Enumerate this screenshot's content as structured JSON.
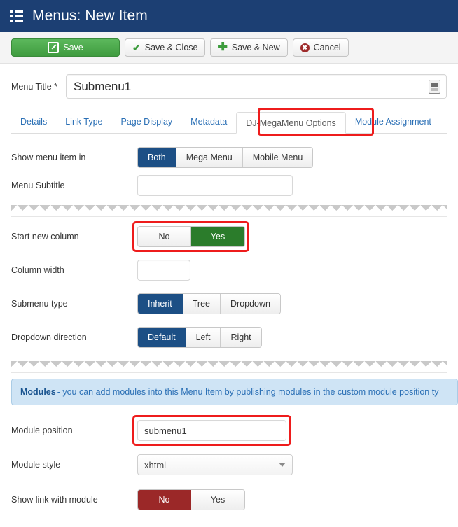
{
  "header": {
    "icon": "menu-list-icon",
    "title": "Menus: New Item"
  },
  "toolbar": {
    "save_label": "Save",
    "save_close_label": "Save & Close",
    "save_new_label": "Save & New",
    "cancel_label": "Cancel",
    "save_icon": "edit-pencil-icon",
    "save_close_icon": "check-icon",
    "save_new_icon": "plus-icon",
    "cancel_icon": "close-circle-icon"
  },
  "menu_title": {
    "label": "Menu Title *",
    "value": "Submenu1",
    "addon_icon": "article-icon"
  },
  "tabs": [
    {
      "label": "Details",
      "active": false
    },
    {
      "label": "Link Type",
      "active": false
    },
    {
      "label": "Page Display",
      "active": false
    },
    {
      "label": "Metadata",
      "active": false
    },
    {
      "label": "DJ-MegaMenu Options",
      "active": true
    },
    {
      "label": "Module Assignment",
      "active": false
    }
  ],
  "fields": {
    "show_menu_item_in": {
      "label": "Show menu item in",
      "options": [
        "Both",
        "Mega Menu",
        "Mobile Menu"
      ],
      "selected": "Both"
    },
    "menu_subtitle": {
      "label": "Menu Subtitle",
      "value": "",
      "placeholder": ""
    },
    "start_new_column": {
      "label": "Start new column",
      "options": [
        "No",
        "Yes"
      ],
      "selected": "Yes"
    },
    "column_width": {
      "label": "Column width",
      "value": "",
      "placeholder": ""
    },
    "submenu_type": {
      "label": "Submenu type",
      "options": [
        "Inherit",
        "Tree",
        "Dropdown"
      ],
      "selected": "Inherit"
    },
    "dropdown_direction": {
      "label": "Dropdown direction",
      "options": [
        "Default",
        "Left",
        "Right"
      ],
      "selected": "Default"
    },
    "modules_alert": {
      "strong": "Modules",
      "text": " - you can add modules into this Menu Item by publishing modules in the custom module position ty"
    },
    "module_position": {
      "label": "Module position",
      "value": "submenu1",
      "placeholder": ""
    },
    "module_style": {
      "label": "Module style",
      "value": "xhtml",
      "options": [
        "xhtml"
      ]
    },
    "show_link_with_module": {
      "label": "Show link with module",
      "options": [
        "No",
        "Yes"
      ],
      "selected": "No"
    }
  },
  "colors": {
    "header_blue": "#1c3f73",
    "accent_blue": "#1c4f85",
    "link_blue": "#2a6fb5",
    "save_green": "#3f9c3f",
    "toggle_green": "#2b7c2b",
    "toggle_red": "#9b2828",
    "highlight_red": "#ee1c1c",
    "alert_bg": "#cfe4f5"
  }
}
